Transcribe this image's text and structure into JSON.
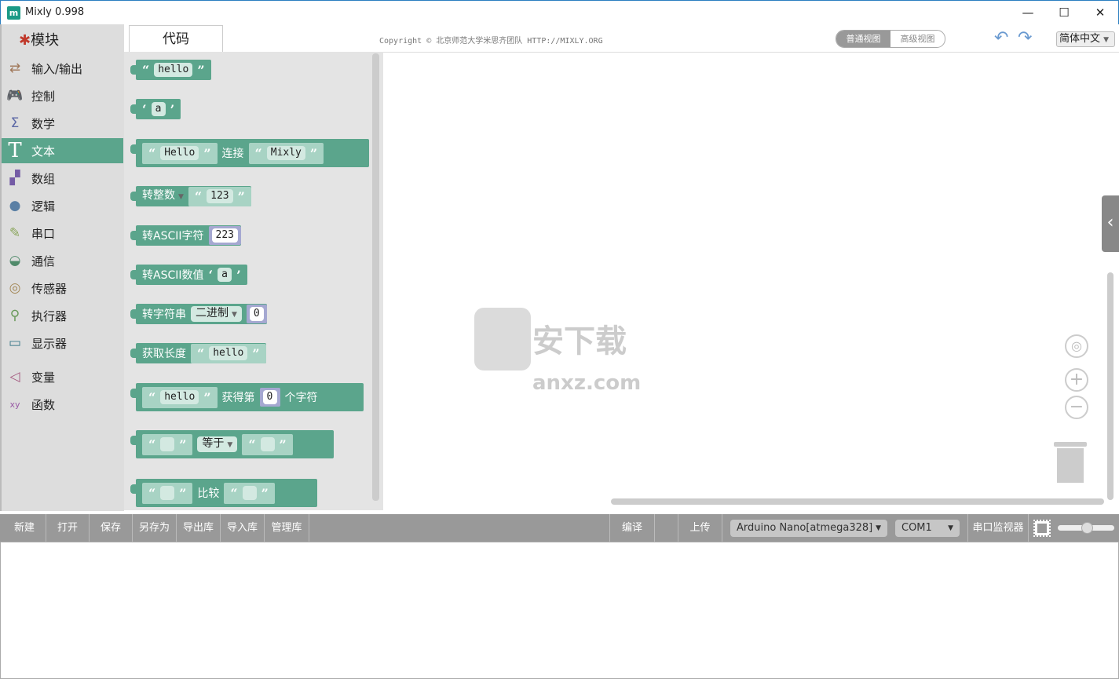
{
  "window": {
    "title": "Mixly 0.998",
    "app_icon": "m",
    "minimize": "—",
    "maximize": "☐",
    "close": "✕"
  },
  "header": {
    "modules_label": "模块",
    "code_tab": "代码",
    "copyright": "Copyright © 北京师范大学米思齐团队 HTTP://MIXLY.ORG",
    "view_normal": "普通视图",
    "view_advanced": "高级视图",
    "language": "简体中文"
  },
  "sidebar": {
    "items": [
      {
        "label": "输入/输出",
        "icon": "arrows-icon",
        "color": "#a0785a"
      },
      {
        "label": "控制",
        "icon": "gamepad-icon",
        "color": "#6ea05a"
      },
      {
        "label": "数学",
        "icon": "sigma-icon",
        "color": "#5b67a5"
      },
      {
        "label": "文本",
        "icon": "text-t-icon",
        "color": "#5ba58c"
      },
      {
        "label": "数组",
        "icon": "grid-icon",
        "color": "#745ba5"
      },
      {
        "label": "逻辑",
        "icon": "bulb-icon",
        "color": "#5b80a5"
      },
      {
        "label": "串口",
        "icon": "plug-icon",
        "color": "#8aa55b"
      },
      {
        "label": "通信",
        "icon": "satellite-icon",
        "color": "#4f8a6a"
      },
      {
        "label": "传感器",
        "icon": "sensor-icon",
        "color": "#a58a5b"
      },
      {
        "label": "执行器",
        "icon": "actuator-icon",
        "color": "#6a9a5b"
      },
      {
        "label": "显示器",
        "icon": "monitor-icon",
        "color": "#3c7a8a"
      },
      {
        "label": "变量",
        "icon": "variable-icon",
        "color": "#a55b80"
      },
      {
        "label": "函数",
        "icon": "function-xy-icon",
        "color": "#995ba5"
      }
    ],
    "selected": "文本"
  },
  "blocks": {
    "b1": {
      "text": "hello"
    },
    "b2": {
      "text": "a"
    },
    "b3": {
      "left": "Hello",
      "op": "连接",
      "right": "Mixly"
    },
    "b4": {
      "dropdown": "转整数",
      "text": "123"
    },
    "b5": {
      "label": "转ASCII字符",
      "num": "223"
    },
    "b6": {
      "label": "转ASCII数值",
      "text": "a"
    },
    "b7": {
      "label": "转字符串",
      "dropdown": "二进制",
      "num": "0"
    },
    "b8": {
      "label": "获取长度",
      "text": "hello"
    },
    "b9": {
      "text": "hello",
      "op": "获得第",
      "num": "0",
      "suffix": "个字符"
    },
    "b10": {
      "left": "",
      "dropdown": "等于",
      "right": ""
    },
    "b11": {
      "left": "",
      "op": "比较",
      "right": ""
    }
  },
  "toolbar": {
    "new": "新建",
    "open": "打开",
    "save": "保存",
    "save_as": "另存为",
    "export_lib": "导出库",
    "import_lib": "导入库",
    "manage_lib": "管理库",
    "compile": "编译",
    "upload": "上传",
    "board": "Arduino Nano[atmega328]",
    "port": "COM1",
    "serial_monitor": "串口监视器"
  },
  "colors": {
    "accent": "#5ba58c",
    "toolbar": "#999999"
  }
}
